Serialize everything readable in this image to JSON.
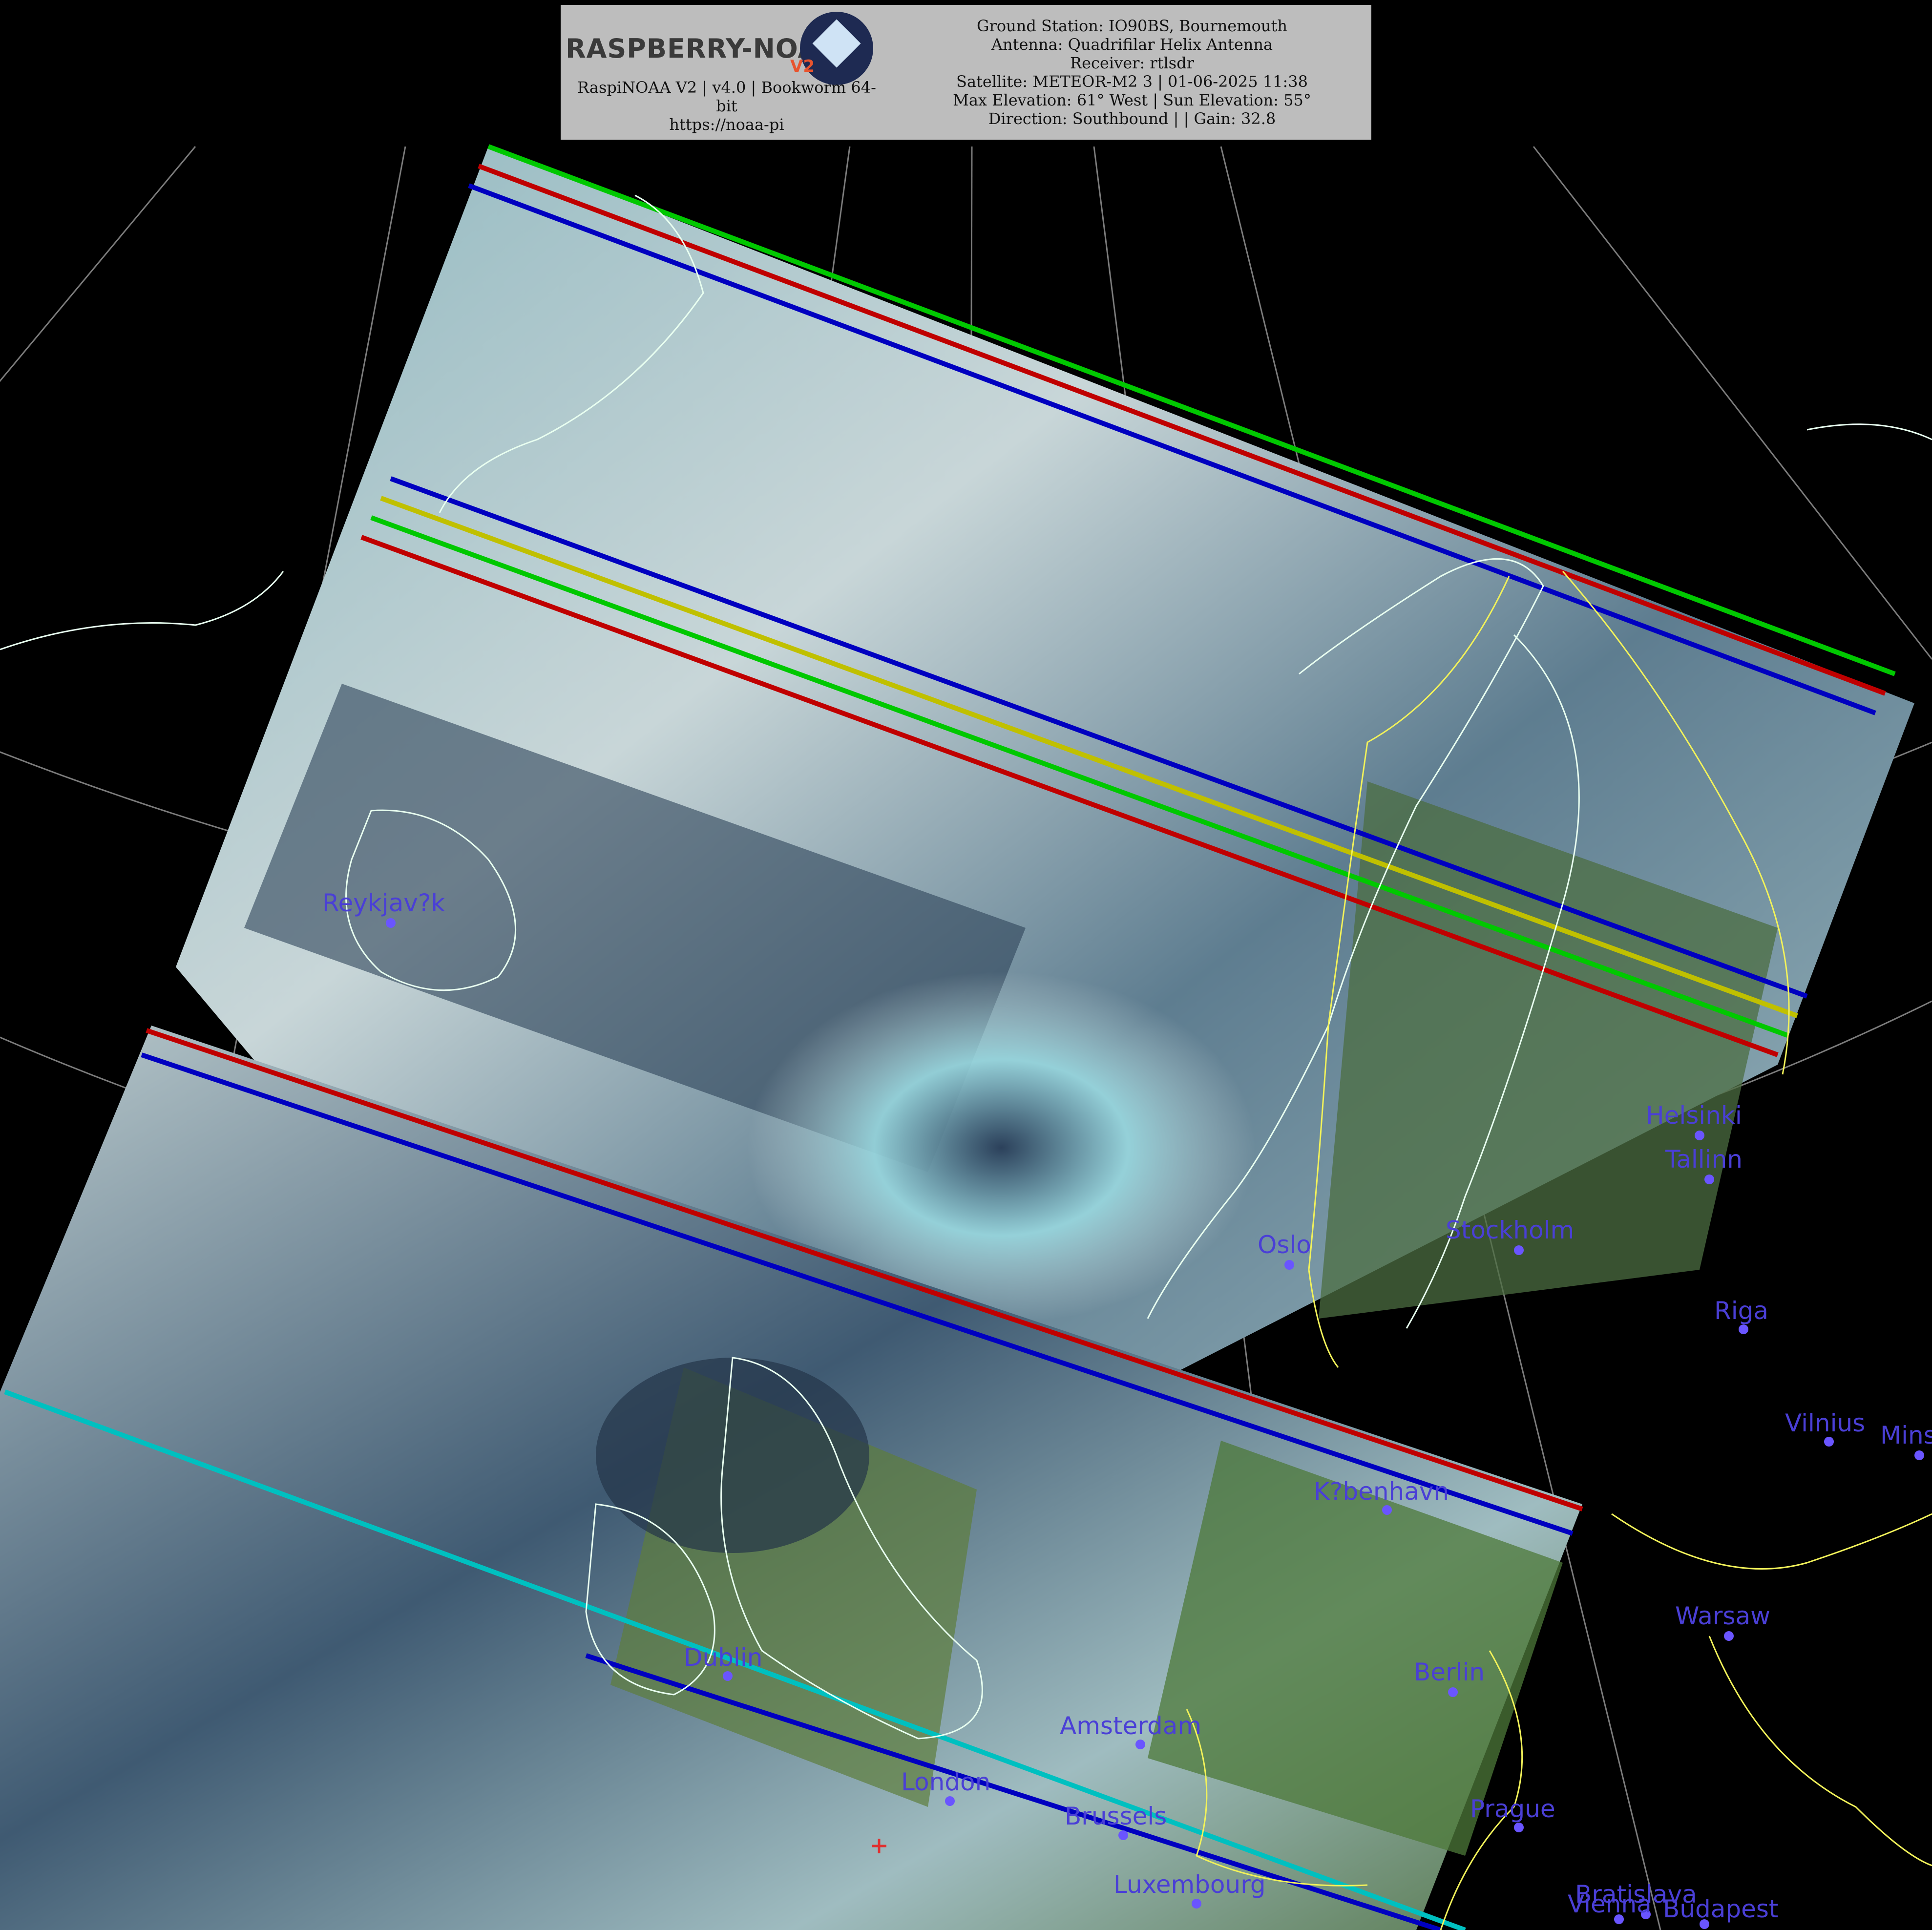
{
  "header": {
    "logo_text": "RASPBERRY-NOAA",
    "logo_badge": "V2",
    "software_line1": "RaspiNOAA V2 | v4.0 | Bookworm 64-",
    "software_line2": "bit",
    "website": "https://noaa-pi",
    "lines": [
      "Ground Station: IO90BS, Bournemouth",
      "Antenna: Quadrifilar Helix Antenna",
      "Receiver: rtlsdr",
      "Satellite: METEOR-M2 3 | 01-06-2025 11:38",
      "Max Elevation: 61° West | Sun Elevation: 55°",
      "Direction: Southbound | | Gain: 32.8"
    ]
  },
  "cities": [
    {
      "name": "Reykjav?k"
    },
    {
      "name": "Helsinki"
    },
    {
      "name": "Tallinn"
    },
    {
      "name": "Stockholm"
    },
    {
      "name": "Oslo"
    },
    {
      "name": "Riga"
    },
    {
      "name": "Vilnius"
    },
    {
      "name": "Mins"
    },
    {
      "name": "K?benhavn"
    },
    {
      "name": "Warsaw"
    },
    {
      "name": "Dublin"
    },
    {
      "name": "Berlin"
    },
    {
      "name": "Amsterdam"
    },
    {
      "name": "London"
    },
    {
      "name": "Brussels"
    },
    {
      "name": "Prague"
    },
    {
      "name": "Luxembourg"
    },
    {
      "name": "Bratislava"
    },
    {
      "name": "Vienna"
    },
    {
      "name": "Budapest"
    }
  ],
  "colors": {
    "city_label": "#4a3fd6",
    "city_dot": "#6a55ff",
    "coastline": "#e8fff0",
    "border": "#f2f25a",
    "graticule": "#9a9a9a",
    "header_bg": "#bdbdbd",
    "ground_station_marker": "#e03030"
  },
  "icons": [
    "satellite-logo-icon",
    "ground-station-marker-icon"
  ]
}
